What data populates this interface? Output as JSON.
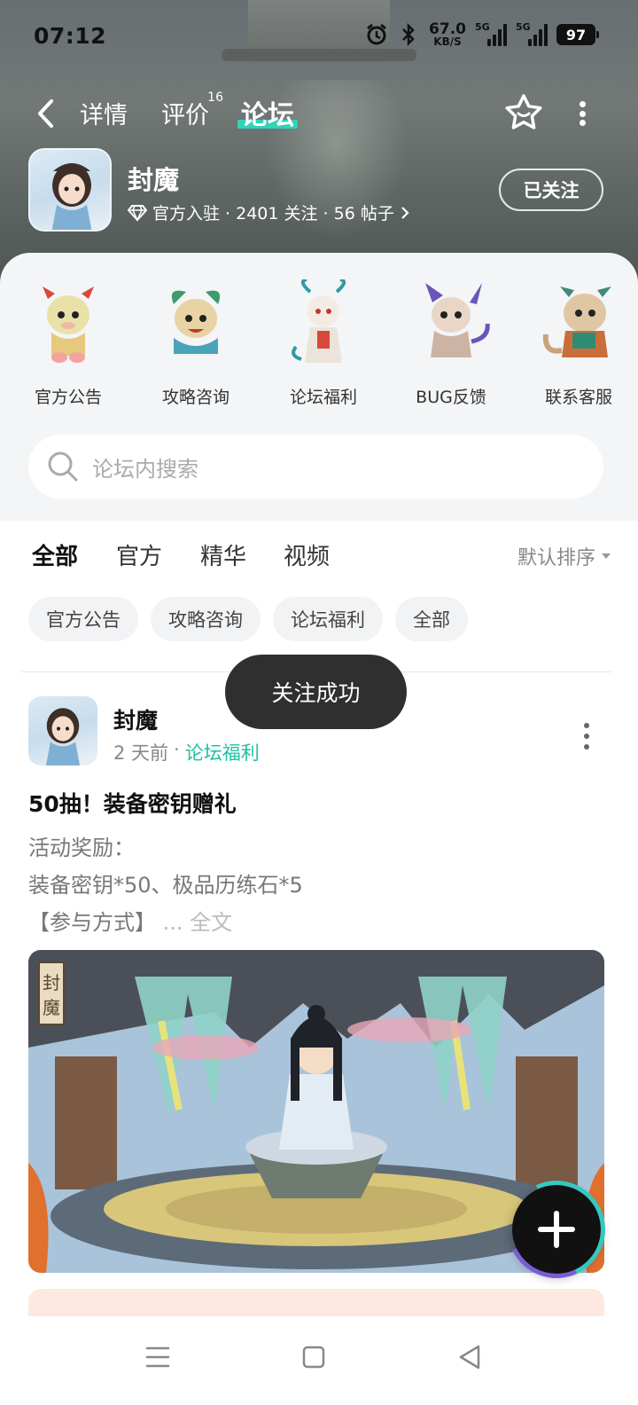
{
  "status_bar": {
    "time": "07:12",
    "net_speed_value": "67.0",
    "net_speed_unit": "KB/S",
    "signal1_tag": "5G",
    "signal2_tag": "5G",
    "battery": "97",
    "icons": [
      "alarm-icon",
      "bluetooth-icon",
      "signal-icon",
      "signal-icon",
      "battery-icon"
    ]
  },
  "nav": {
    "tabs": [
      {
        "label": "详情"
      },
      {
        "label": "评价",
        "badge": "16"
      },
      {
        "label": "论坛",
        "active": true
      }
    ]
  },
  "game": {
    "title": "封魔",
    "meta": "官方入驻 · 2401 关注 · 56 帖子",
    "follow_label": "已关注"
  },
  "categories": [
    {
      "label": "官方公告"
    },
    {
      "label": "攻略咨询"
    },
    {
      "label": "论坛福利"
    },
    {
      "label": "BUG反馈"
    },
    {
      "label": "联系客服"
    }
  ],
  "search": {
    "placeholder": "论坛内搜索"
  },
  "feed": {
    "tabs": [
      "全部",
      "官方",
      "精华",
      "视频"
    ],
    "sort_label": "默认排序",
    "chips": [
      "官方公告",
      "攻略咨询",
      "论坛福利",
      "全部"
    ]
  },
  "post": {
    "author": "封魔",
    "time": "2 天前",
    "separator": "·",
    "category": "论坛福利",
    "title": "50抽！装备密钥赠礼",
    "lines": [
      "活动奖励：",
      "装备密钥*50、极品历练石*5",
      "【参与方式】"
    ],
    "more_label": "... 全文",
    "image_seal": "封魔"
  },
  "toast": "关注成功",
  "colors": {
    "accent": "#2fd4b8",
    "link": "#1fbfa5",
    "toast_bg": "#2f2f2f"
  }
}
